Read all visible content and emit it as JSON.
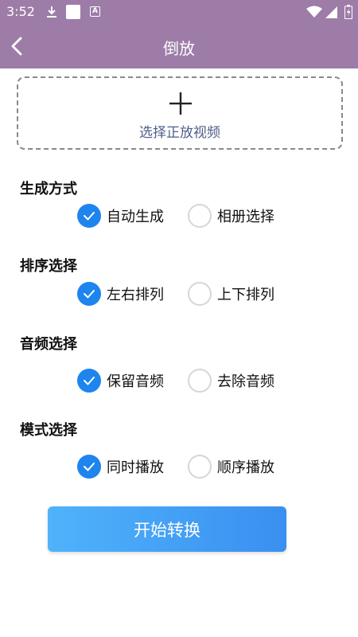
{
  "status_bar": {
    "time": "3:52",
    "icons": [
      "download-icon",
      "notification-square-icon",
      "a-badge-icon",
      "wifi-icon",
      "signal-icon",
      "battery-icon"
    ],
    "a_badge": "A"
  },
  "app_bar": {
    "title": "倒放",
    "background": "#9d7ca8",
    "back_icon": "chevron-left-icon"
  },
  "upload": {
    "icon": "plus-icon",
    "label": "选择正放视频"
  },
  "sections": [
    {
      "title": "生成方式",
      "options": [
        {
          "label": "自动生成",
          "selected": true
        },
        {
          "label": "相册选择",
          "selected": false
        }
      ]
    },
    {
      "title": "排序选择",
      "options": [
        {
          "label": "左右排列",
          "selected": true
        },
        {
          "label": "上下排列",
          "selected": false
        }
      ]
    },
    {
      "title": "音频选择",
      "options": [
        {
          "label": "保留音频",
          "selected": true
        },
        {
          "label": "去除音频",
          "selected": false
        }
      ]
    },
    {
      "title": "模式选择",
      "options": [
        {
          "label": "同时播放",
          "selected": true
        },
        {
          "label": "顺序播放",
          "selected": false
        }
      ]
    }
  ],
  "start_button": {
    "label": "开始转换"
  },
  "colors": {
    "accent": "#1e84ee",
    "header": "#9d7ca8",
    "upload_label": "#4f5e8a"
  }
}
